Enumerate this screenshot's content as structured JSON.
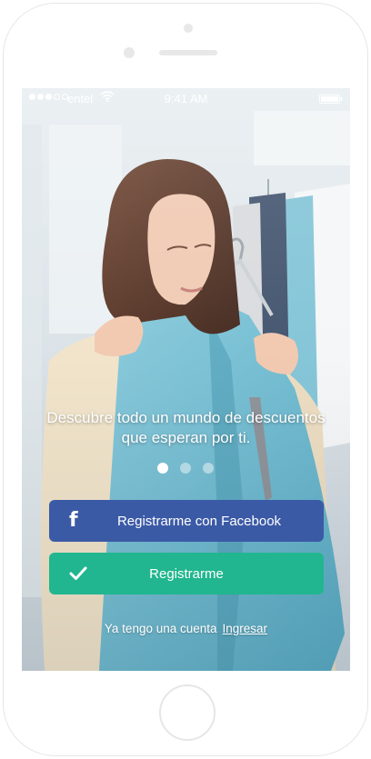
{
  "status_bar": {
    "carrier": "entel",
    "time": "9:41 AM",
    "signal_bars": 3,
    "signal_total": 5
  },
  "background": {
    "image": "woman-holding-teal-cardigan-in-clothing-store"
  },
  "onboarding": {
    "tagline": "Descubre todo un mundo de descuentos que esperan por ti.",
    "page_count": 3,
    "active_page": 1
  },
  "buttons": {
    "facebook_label": "Registrarme con Facebook",
    "facebook_icon": "facebook-icon",
    "facebook_color": "#3b5aa6",
    "register_label": "Registrarme",
    "register_icon": "checkmark-icon",
    "register_color": "#21b68f"
  },
  "login": {
    "prompt": "Ya tengo una cuenta",
    "link": "Ingresar"
  }
}
